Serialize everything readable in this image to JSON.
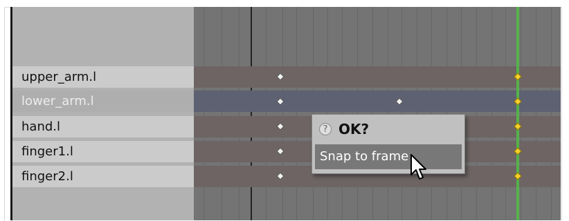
{
  "channels": [
    {
      "label": "upper_arm.l",
      "selected": false
    },
    {
      "label": "lower_arm.l",
      "selected": true
    },
    {
      "label": "hand.l",
      "selected": false
    },
    {
      "label": "finger1.l",
      "selected": false
    },
    {
      "label": "finger2.l",
      "selected": false
    }
  ],
  "popup": {
    "title": "OK?",
    "item_label": "Snap to frame",
    "help_icon_glyph": "?"
  },
  "icons": {
    "help": "question-mark-icon",
    "cursor": "mouse-pointer-icon"
  },
  "colors": {
    "current_frame": "#55b24a",
    "selected_key": "#f5cf2b",
    "unselected_key": "#f2f2f2"
  }
}
